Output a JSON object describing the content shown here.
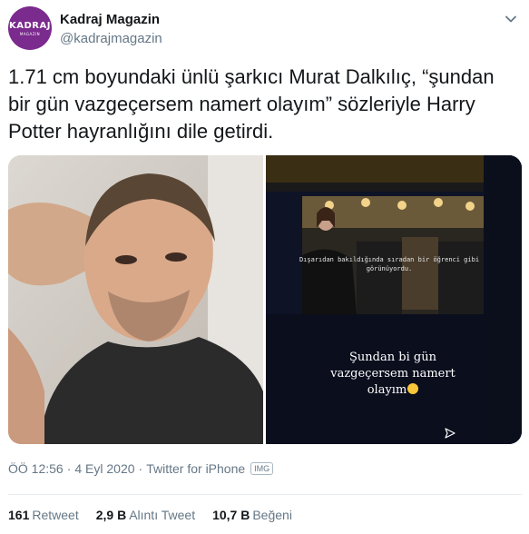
{
  "author": {
    "name": "Kadraj Magazin",
    "handle": "@kadrajmagazin",
    "avatar_logo": "KADRAJ",
    "avatar_sub": "MAGAZIN",
    "avatar_color": "#7b2a8e"
  },
  "tweet": {
    "text": "1.71 cm boyundaki ünlü şarkıcı Murat Dalkılıç, “şundan bir gün vazgeçersem namert olayım” sözleriyle Harry Potter hayranlığını dile getirdi."
  },
  "media": {
    "story_caption_small": "Dışarıdan bakıldığında sıradan bir öğrenci gibi görünüyordu.",
    "story_caption_large": "Şundan bi gün vazgeçersem namert olayım"
  },
  "meta": {
    "time": "ÖÖ 12:56",
    "separator": "·",
    "date": "4 Eyl 2020",
    "source": "Twitter for iPhone",
    "badge": "IMG"
  },
  "stats": [
    {
      "count": "161",
      "label": "Retweet"
    },
    {
      "count": "2,9 B",
      "label": "Alıntı Tweet"
    },
    {
      "count": "10,7 B",
      "label": "Beğeni"
    }
  ],
  "colors": {
    "text_primary": "#14171a",
    "text_secondary": "#657786",
    "divider": "#e6ecf0"
  },
  "icons": [
    "chevron-down-icon",
    "send-icon",
    "emoji-icon"
  ]
}
